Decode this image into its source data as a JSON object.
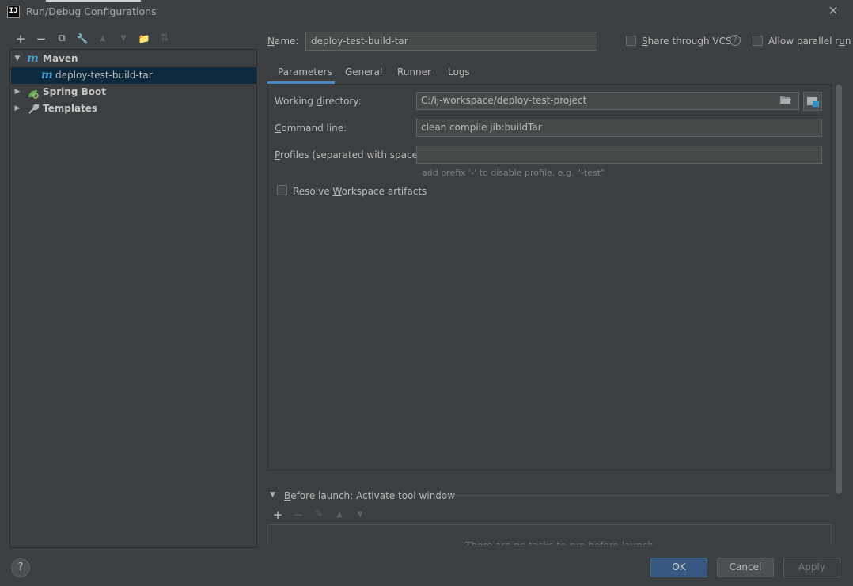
{
  "window": {
    "title": "Run/Debug Configurations",
    "app_icon_text": "IJ",
    "close_glyph": "✕"
  },
  "toolbar": {
    "add": "+",
    "remove": "−",
    "copy": "⧉",
    "edit": "🔧",
    "move_up": "▲",
    "move_down": "▼",
    "new_folder": "📁",
    "sort": "⇅"
  },
  "tree": {
    "items": [
      {
        "label": "Maven",
        "expanded": true,
        "icon": "maven-icon"
      },
      {
        "label": "deploy-test-build-tar",
        "selected": true,
        "icon": "maven-icon"
      },
      {
        "label": "Spring Boot",
        "expanded": false,
        "icon": "spring-boot-icon"
      },
      {
        "label": "Templates",
        "expanded": false,
        "icon": "wrench-icon"
      }
    ],
    "maven_glyph": "m"
  },
  "name": {
    "label_prefix": "N",
    "label_rest": "ame:",
    "value": "deploy-test-build-tar"
  },
  "options": {
    "share_vcs": {
      "label_prefix": "S",
      "label_rest": "hare through VCS",
      "checked": false
    },
    "help_glyph": "?",
    "parallel": {
      "label_prefix": "Allow parallel r",
      "label_u": "u",
      "label_rest": "n",
      "checked": false
    }
  },
  "tabs": [
    {
      "label": "Parameters",
      "active": true
    },
    {
      "label": "General",
      "active": false
    },
    {
      "label": "Runner",
      "active": false
    },
    {
      "label": "Logs",
      "active": false
    }
  ],
  "parameters": {
    "working_dir": {
      "label_a": "Working ",
      "label_u": "d",
      "label_b": "irectory:",
      "value": "C:/ij-workspace/deploy-test-project"
    },
    "command_line": {
      "label_u": "C",
      "label_b": "ommand line:",
      "value": "clean compile jib:buildTar"
    },
    "profiles": {
      "label_u": "P",
      "label_b": "rofiles (separated with space):",
      "value": "",
      "hint": "add prefix '-' to disable profile, e.g. \"-test\""
    },
    "resolve": {
      "label_a": "Resolve ",
      "label_u": "W",
      "label_b": "orkspace artifacts",
      "checked": false
    }
  },
  "before_launch": {
    "title_u": "B",
    "title_rest": "efore launch: Activate tool window",
    "empty_text": "There are no tasks to run before launch",
    "toolbar": {
      "add": "+",
      "remove": "−",
      "edit": "✎",
      "up": "▲",
      "down": "▼"
    }
  },
  "buttons": {
    "ok": "OK",
    "cancel": "Cancel",
    "apply": "Apply",
    "help": "?"
  }
}
